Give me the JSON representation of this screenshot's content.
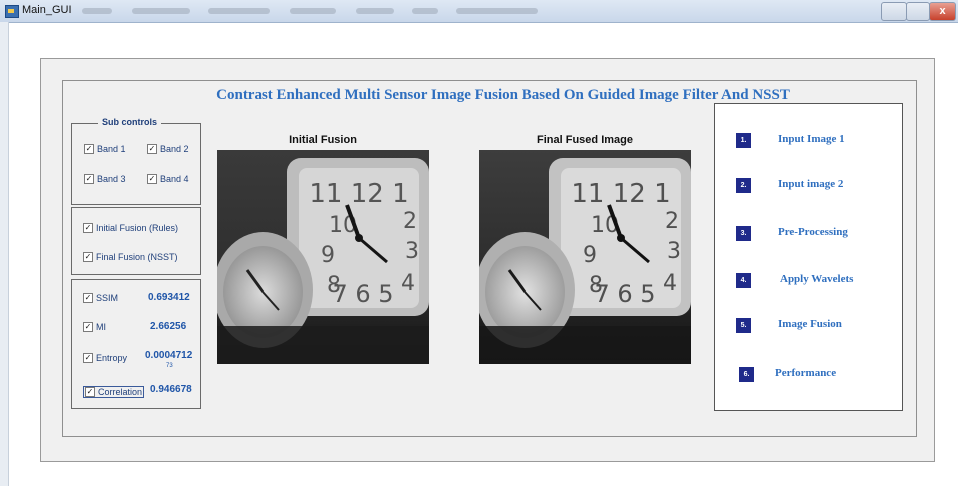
{
  "window": {
    "title": "Main_GUI",
    "close_label": "x"
  },
  "main": {
    "title": "Contrast Enhanced Multi Sensor Image Fusion Based On Guided Image Filter And NSST"
  },
  "sub_controls": {
    "legend": "Sub controls",
    "bands": [
      {
        "label": "Band 1",
        "checked": true
      },
      {
        "label": "Band 2",
        "checked": true
      },
      {
        "label": "Band 3",
        "checked": true
      },
      {
        "label": "Band 4",
        "checked": true
      }
    ]
  },
  "fusion_options": [
    {
      "label": "Initial Fusion (Rules)",
      "checked": true
    },
    {
      "label": "Final Fusion (NSST)",
      "checked": true
    }
  ],
  "metrics": [
    {
      "label": "SSIM",
      "value": "0.693412",
      "checked": true
    },
    {
      "label": "MI",
      "value": "2.66256",
      "checked": true
    },
    {
      "label": "Entropy",
      "value": "0.0004712",
      "sub": "73",
      "checked": true
    },
    {
      "label": "Correlation",
      "value": "0.946678",
      "checked": true
    }
  ],
  "images": {
    "initial_title": "Initial Fusion",
    "final_title": "Final Fused Image"
  },
  "steps": [
    {
      "num": "1.",
      "label": "Input Image 1"
    },
    {
      "num": "2.",
      "label": "Input image 2"
    },
    {
      "num": "3.",
      "label": "Pre-Processing"
    },
    {
      "num": "4.",
      "label": "Apply Wavelets"
    },
    {
      "num": "5.",
      "label": "Image Fusion"
    },
    {
      "num": "6.",
      "label": "Performance"
    }
  ],
  "colors": {
    "title_blue": "#2f6fbf",
    "step_badge": "#1f2a8a",
    "metric_blue": "#1f55a8"
  }
}
